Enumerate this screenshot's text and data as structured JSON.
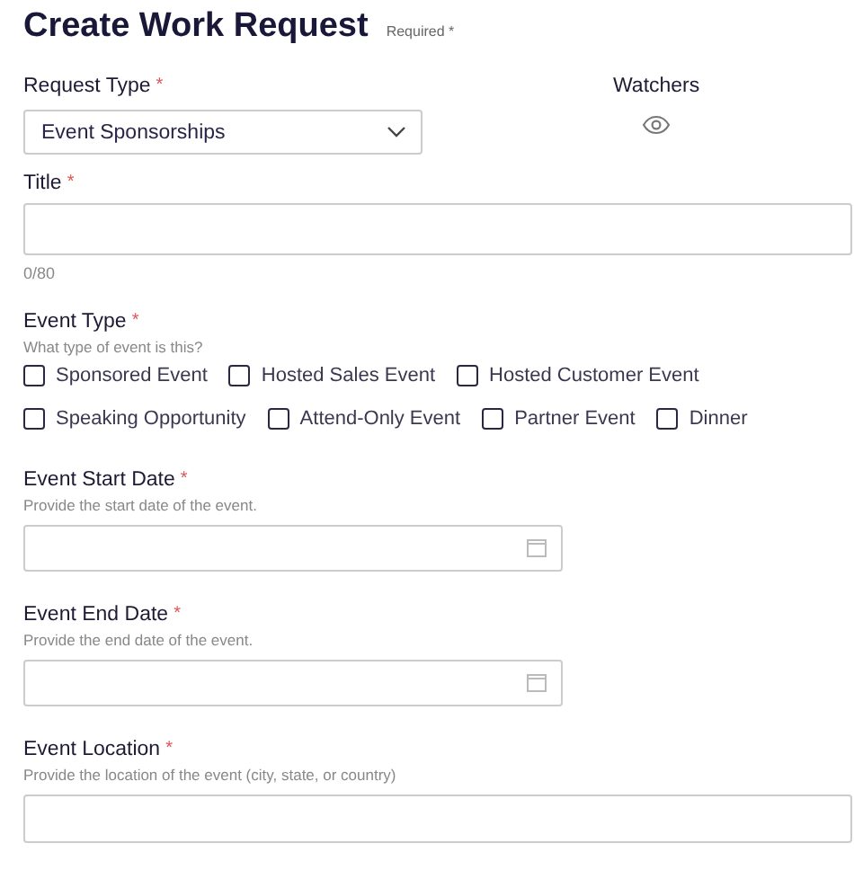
{
  "header": {
    "title": "Create Work Request",
    "required_note": "Required *"
  },
  "request_type": {
    "label": "Request Type",
    "marker": "*",
    "value": "Event Sponsorships"
  },
  "watchers": {
    "label": "Watchers"
  },
  "title_field": {
    "label": "Title",
    "marker": "*",
    "counter": "0/80"
  },
  "event_type": {
    "label": "Event Type",
    "marker": "*",
    "hint": "What type of event is this?",
    "rows": [
      [
        {
          "label": "Sponsored Event",
          "checked": false
        },
        {
          "label": "Hosted Sales Event",
          "checked": false
        },
        {
          "label": "Hosted Customer Event",
          "checked": false
        }
      ],
      [
        {
          "label": "Speaking Opportunity",
          "checked": false
        },
        {
          "label": "Attend-Only Event",
          "checked": false
        },
        {
          "label": "Partner Event",
          "checked": false
        },
        {
          "label": "Dinner",
          "checked": false
        }
      ]
    ]
  },
  "fields": [
    {
      "kind": "date",
      "label": "Event Start Date",
      "marker": "*",
      "hint": "Provide the start date of the event."
    },
    {
      "kind": "date",
      "label": "Event End Date",
      "marker": "*",
      "hint": "Provide the end date of the event."
    },
    {
      "kind": "text",
      "label": "Event Location",
      "marker": "*",
      "hint": "Provide the location of the event (city, state, or country)"
    }
  ]
}
